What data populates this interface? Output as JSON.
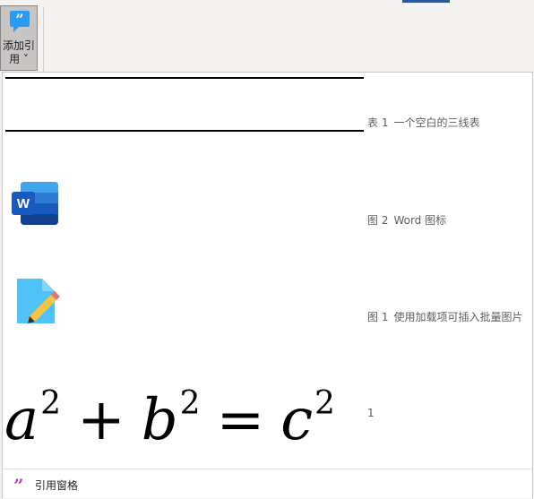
{
  "ribbon": {
    "add_citation_label_line1": "添加引",
    "add_citation_label_line2": "用 ˅"
  },
  "items": [
    {
      "kind": "table",
      "prefix": "表 1",
      "caption": "一个空白的三线表"
    },
    {
      "kind": "word-icon",
      "prefix": "图 2",
      "caption": "Word 图标"
    },
    {
      "kind": "addin-icon",
      "prefix": "图 1",
      "caption": "使用加载项可插入批量图片"
    },
    {
      "kind": "equation",
      "prefix": "",
      "caption": "1",
      "equation": {
        "a": "a",
        "b": "b",
        "c": "c",
        "exp": "2",
        "plus": "+",
        "equals": "="
      }
    }
  ],
  "footer": {
    "label": "引用窗格"
  },
  "colors": {
    "accent": "#2b579a",
    "quote_icon": "#b146c2",
    "caption_text": "#605e5c"
  }
}
